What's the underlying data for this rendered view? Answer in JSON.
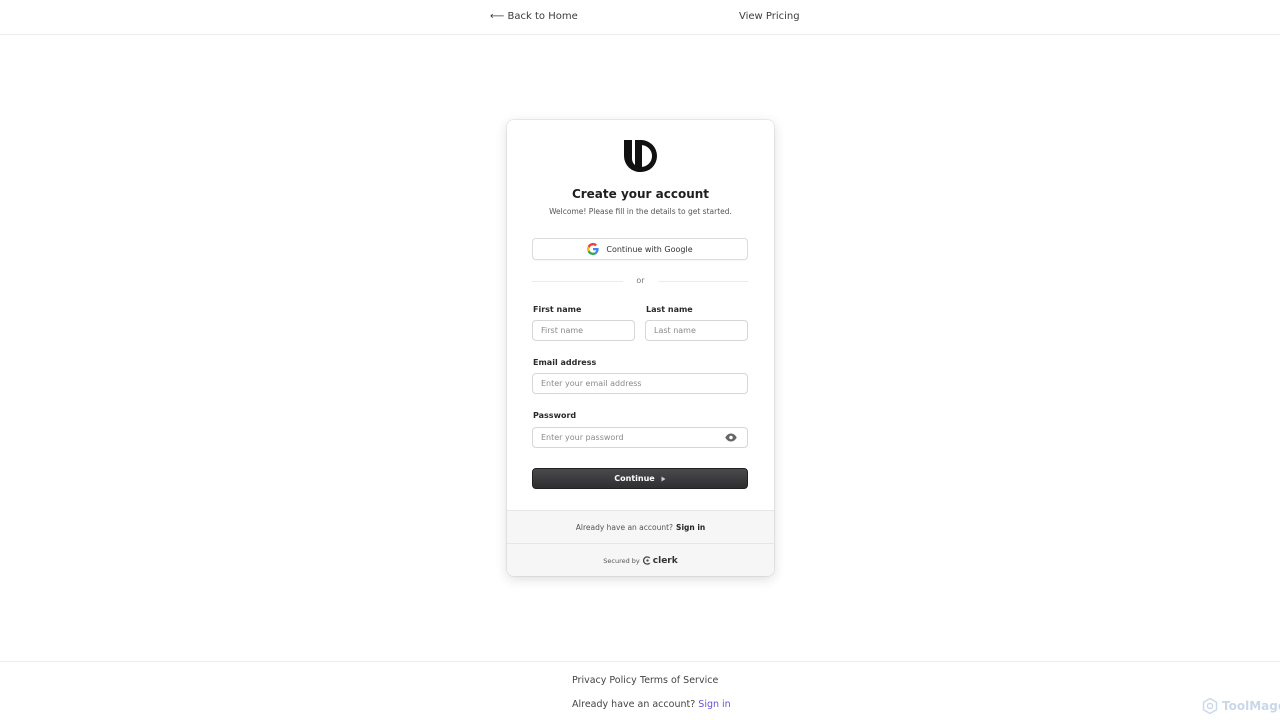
{
  "topbar": {
    "back_label": "⟵ Back to Home",
    "pricing_label": "View Pricing"
  },
  "card": {
    "logo_icon": "brand-logo-icon",
    "title": "Create your account",
    "subtitle": "Welcome! Please fill in the details to get started.",
    "google_button_label": "Continue with Google",
    "divider_text": "or",
    "first_name": {
      "label": "First name",
      "placeholder": "First name",
      "value": ""
    },
    "last_name": {
      "label": "Last name",
      "placeholder": "Last name",
      "value": ""
    },
    "email": {
      "label": "Email address",
      "placeholder": "Enter your email address",
      "value": ""
    },
    "password": {
      "label": "Password",
      "placeholder": "Enter your password",
      "value": "",
      "toggle_icon": "eye-icon"
    },
    "continue_label": "Continue",
    "footer": {
      "question": "Already have an account?",
      "signin_label": "Sign in",
      "secured_by": "Secured by",
      "provider": "clerk"
    }
  },
  "footer": {
    "privacy_label": "Privacy Policy",
    "terms_label": "Terms of Service",
    "question": "Already have an account?",
    "signin_label": "Sign in"
  },
  "watermark": {
    "text": "ToolMage"
  },
  "colors": {
    "accent_link": "#6b4fd8",
    "button_dark": "#2f2f31",
    "card_footer_bg": "#f6f6f6"
  }
}
